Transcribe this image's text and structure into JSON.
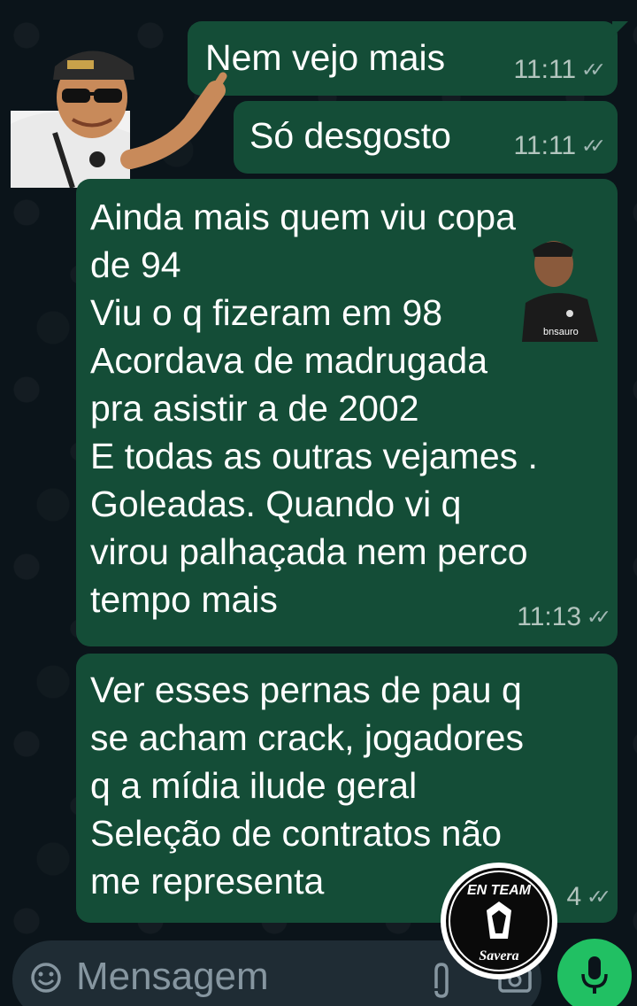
{
  "messages": [
    {
      "text": "Nem vejo mais",
      "time": "11:11"
    },
    {
      "text": "Só desgosto",
      "time": "11:11"
    },
    {
      "text": "Ainda mais quem viu copa\nde 94\nViu o q fizeram em 98\nAcordava de madrugada\npra asistir a de 2002\nE todas as outras vejames .\nGoleadas. Quando vi q\nvirou palhaçada nem perco\ntempo mais",
      "time": "11:13"
    },
    {
      "text": "Ver esses pernas de pau q\nse acham crack, jogadores\nq a mídia ilude geral\nSeleção de contratos não\nme representa",
      "time_partial": "4"
    }
  ],
  "stickers": {
    "small_caption": "bnsauro",
    "logo_top": "EN TEAM",
    "logo_bottom": "Savera"
  },
  "input": {
    "placeholder": "Mensagem"
  },
  "icons": {
    "ticks": "✓✓",
    "emoji": "emoji-icon",
    "attach": "paperclip-icon",
    "camera": "camera-icon",
    "mic": "microphone-icon"
  },
  "colors": {
    "background": "#0b141a",
    "outgoing_bubble": "#144d37",
    "input_bar": "#1f2c34",
    "mic_button": "#21c063"
  }
}
